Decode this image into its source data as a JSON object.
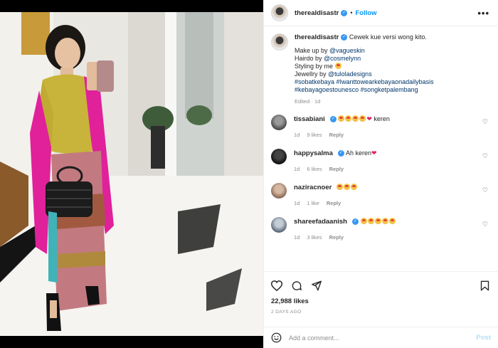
{
  "post": {
    "username": "therealdisastr",
    "follow_label": "Follow",
    "more_label": "•••",
    "caption": {
      "text": "Cewek kue versi wong kito.",
      "lines": [
        {
          "prefix": "Make up by ",
          "mention": "@vagueskin"
        },
        {
          "prefix": "Hairdo by ",
          "mention": "@cosmelynn"
        },
        {
          "prefix": "Styling by me ",
          "mention": ""
        },
        {
          "prefix": "Jewellry by ",
          "mention": "@tuloladesigns"
        }
      ],
      "hashtags_1": "#sobatkebaya #Iwanttowearkebayaonadailybasis",
      "hashtags_2": "#kebayagoestounesco #songketpalembang",
      "edited": "Edited",
      "edited_time": "1d"
    },
    "comments": [
      {
        "username": "tissabiani",
        "text": "keren",
        "time": "1d",
        "likes": "9 likes",
        "reply": "Reply",
        "emoji_count": 4,
        "heart": true,
        "avatar_color": "#6b6b6b"
      },
      {
        "username": "happysalma",
        "text": "Ah keren",
        "time": "1d",
        "likes": "6 likes",
        "reply": "Reply",
        "emoji_count": 0,
        "heart": true,
        "avatar_color": "#1a1a1a"
      },
      {
        "username": "naziracnoer",
        "text": "",
        "time": "1d",
        "likes": "1 like",
        "reply": "Reply",
        "emoji_count": 3,
        "heart": false,
        "avatar_color": "#a98f7c"
      },
      {
        "username": "shareefadaanish",
        "text": "",
        "time": "1d",
        "likes": "3 likes",
        "reply": "Reply",
        "emoji_count": 5,
        "heart": false,
        "avatar_color": "#7c8a9a"
      }
    ],
    "likes_count": "22,988 likes",
    "date": "2 DAYS AGO",
    "add_comment_placeholder": "Add a comment...",
    "post_button": "Post"
  },
  "icons": {
    "like": "heart-icon",
    "comment": "comment-bubble-icon",
    "share": "paper-plane-icon",
    "save": "bookmark-icon",
    "emoji": "smiley-icon",
    "verified": "verified-badge-icon"
  },
  "colors": {
    "accent": "#0095f6",
    "verified": "#3897f0",
    "muted": "#8e8e8e",
    "heart_red": "#e0245e"
  }
}
